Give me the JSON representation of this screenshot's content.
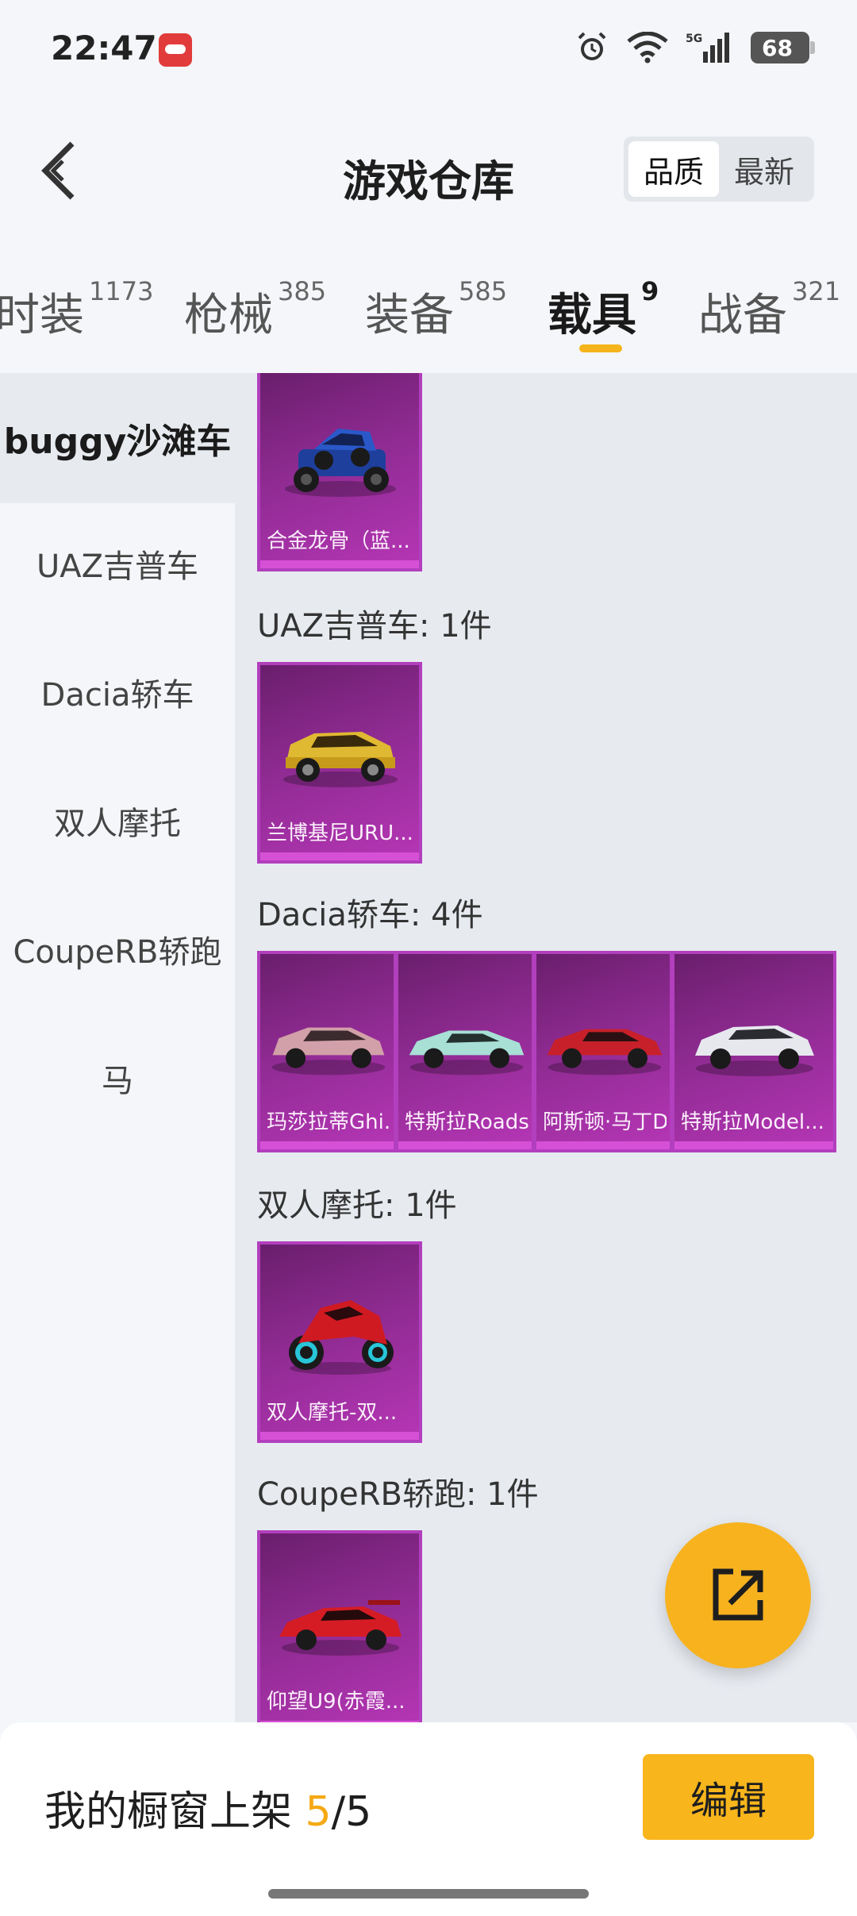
{
  "status_bar": {
    "time": "22:47",
    "battery": "68"
  },
  "header": {
    "title": "游戏仓库",
    "sort_options": [
      "品质",
      "最新"
    ],
    "active_sort": "品质"
  },
  "tabs": [
    {
      "label": "时装",
      "count": "1173",
      "active": false
    },
    {
      "label": "枪械",
      "count": "385",
      "active": false
    },
    {
      "label": "装备",
      "count": "585",
      "active": false
    },
    {
      "label": "载具",
      "count": "9",
      "active": true
    },
    {
      "label": "战备",
      "count": "321",
      "active": false
    }
  ],
  "sidebar": {
    "items": [
      {
        "label": "buggy沙滩车",
        "active": true
      },
      {
        "label": "UAZ吉普车",
        "active": false
      },
      {
        "label": "Dacia轿车",
        "active": false
      },
      {
        "label": "双人摩托",
        "active": false
      },
      {
        "label": "CoupeRB轿跑",
        "active": false
      },
      {
        "label": "马",
        "active": false
      }
    ]
  },
  "sections": [
    {
      "title": "",
      "cards": [
        {
          "name": "合金龙骨（蓝...",
          "art": "buggy"
        }
      ]
    },
    {
      "title": "UAZ吉普车: 1件",
      "cards": [
        {
          "name": "兰博基尼URU...",
          "art": "suv-yellow"
        }
      ]
    },
    {
      "title": "Dacia轿车: 4件",
      "cards": [
        {
          "name": "玛莎拉蒂Ghi...",
          "art": "car-pink"
        },
        {
          "name": "特斯拉Roadst...",
          "art": "car-mint"
        },
        {
          "name": "阿斯顿·马丁D...",
          "art": "car-red"
        },
        {
          "name": "特斯拉Model...",
          "art": "car-white"
        }
      ]
    },
    {
      "title": "双人摩托: 1件",
      "cards": [
        {
          "name": "双人摩托-双...",
          "art": "moto-red"
        }
      ]
    },
    {
      "title": "CoupeRB轿跑: 1件",
      "cards": [
        {
          "name": "仰望U9(赤霞...",
          "art": "supercar-red"
        }
      ]
    }
  ],
  "bottom_bar": {
    "showcase_label": "我的橱窗上架",
    "showcase_count": "5",
    "showcase_total": "/5",
    "edit_label": "编辑"
  },
  "colors": {
    "accent": "#f7b21e",
    "card_purple": "#8f2b92"
  }
}
